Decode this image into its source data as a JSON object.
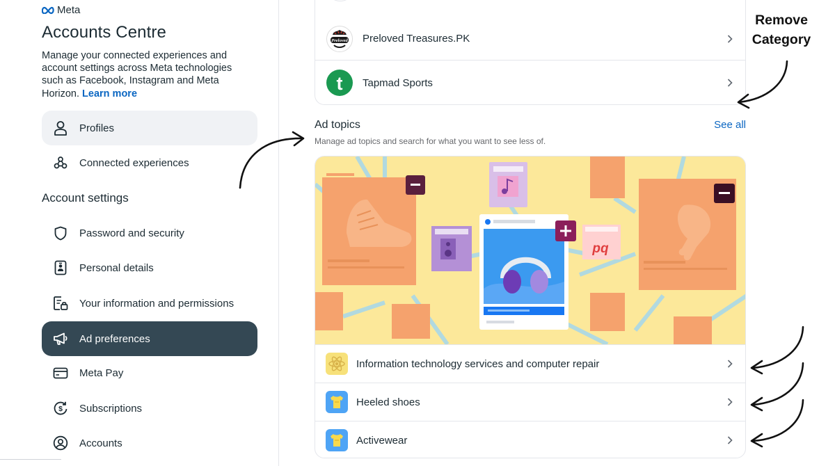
{
  "brand": "Meta",
  "sidebar": {
    "title": "Accounts Centre",
    "description": "Manage your connected experiences and account settings across Meta technologies such as Facebook, Instagram and Meta Horizon.",
    "learn_more": "Learn more",
    "top_items": [
      {
        "label": "Profiles",
        "icon": "person-icon"
      },
      {
        "label": "Connected experiences",
        "icon": "connected-nodes-icon"
      }
    ],
    "section_title": "Account settings",
    "settings_items": [
      {
        "label": "Password and security",
        "icon": "shield-icon"
      },
      {
        "label": "Personal details",
        "icon": "id-card-icon"
      },
      {
        "label": "Your information and permissions",
        "icon": "info-lock-icon"
      },
      {
        "label": "Ad preferences",
        "icon": "megaphone-icon",
        "active": true
      },
      {
        "label": "Meta Pay",
        "icon": "card-icon"
      },
      {
        "label": "Subscriptions",
        "icon": "dollar-cycle-icon"
      },
      {
        "label": "Accounts",
        "icon": "account-circle-icon"
      }
    ]
  },
  "advertisers": [
    {
      "name": "Preloved Treasures.PK",
      "logo_text": "Preloved"
    },
    {
      "name": "Tapmad Sports",
      "logo_text": "t"
    }
  ],
  "ad_topics": {
    "title": "Ad topics",
    "description": "Manage ad topics and search for what you want to see less of.",
    "see_all": "See all",
    "illustration_text": "pq",
    "items": [
      {
        "label": "Information technology services and computer repair",
        "icon": "atom-icon"
      },
      {
        "label": "Heeled shoes",
        "icon": "shirt-icon"
      },
      {
        "label": "Activewear",
        "icon": "shirt-icon"
      }
    ]
  },
  "annotation": {
    "label_line1": "Remove",
    "label_line2": "Category"
  },
  "colors": {
    "active_bg": "#344854",
    "link": "#0a66c2",
    "illustration_bg": "#fce89a"
  }
}
